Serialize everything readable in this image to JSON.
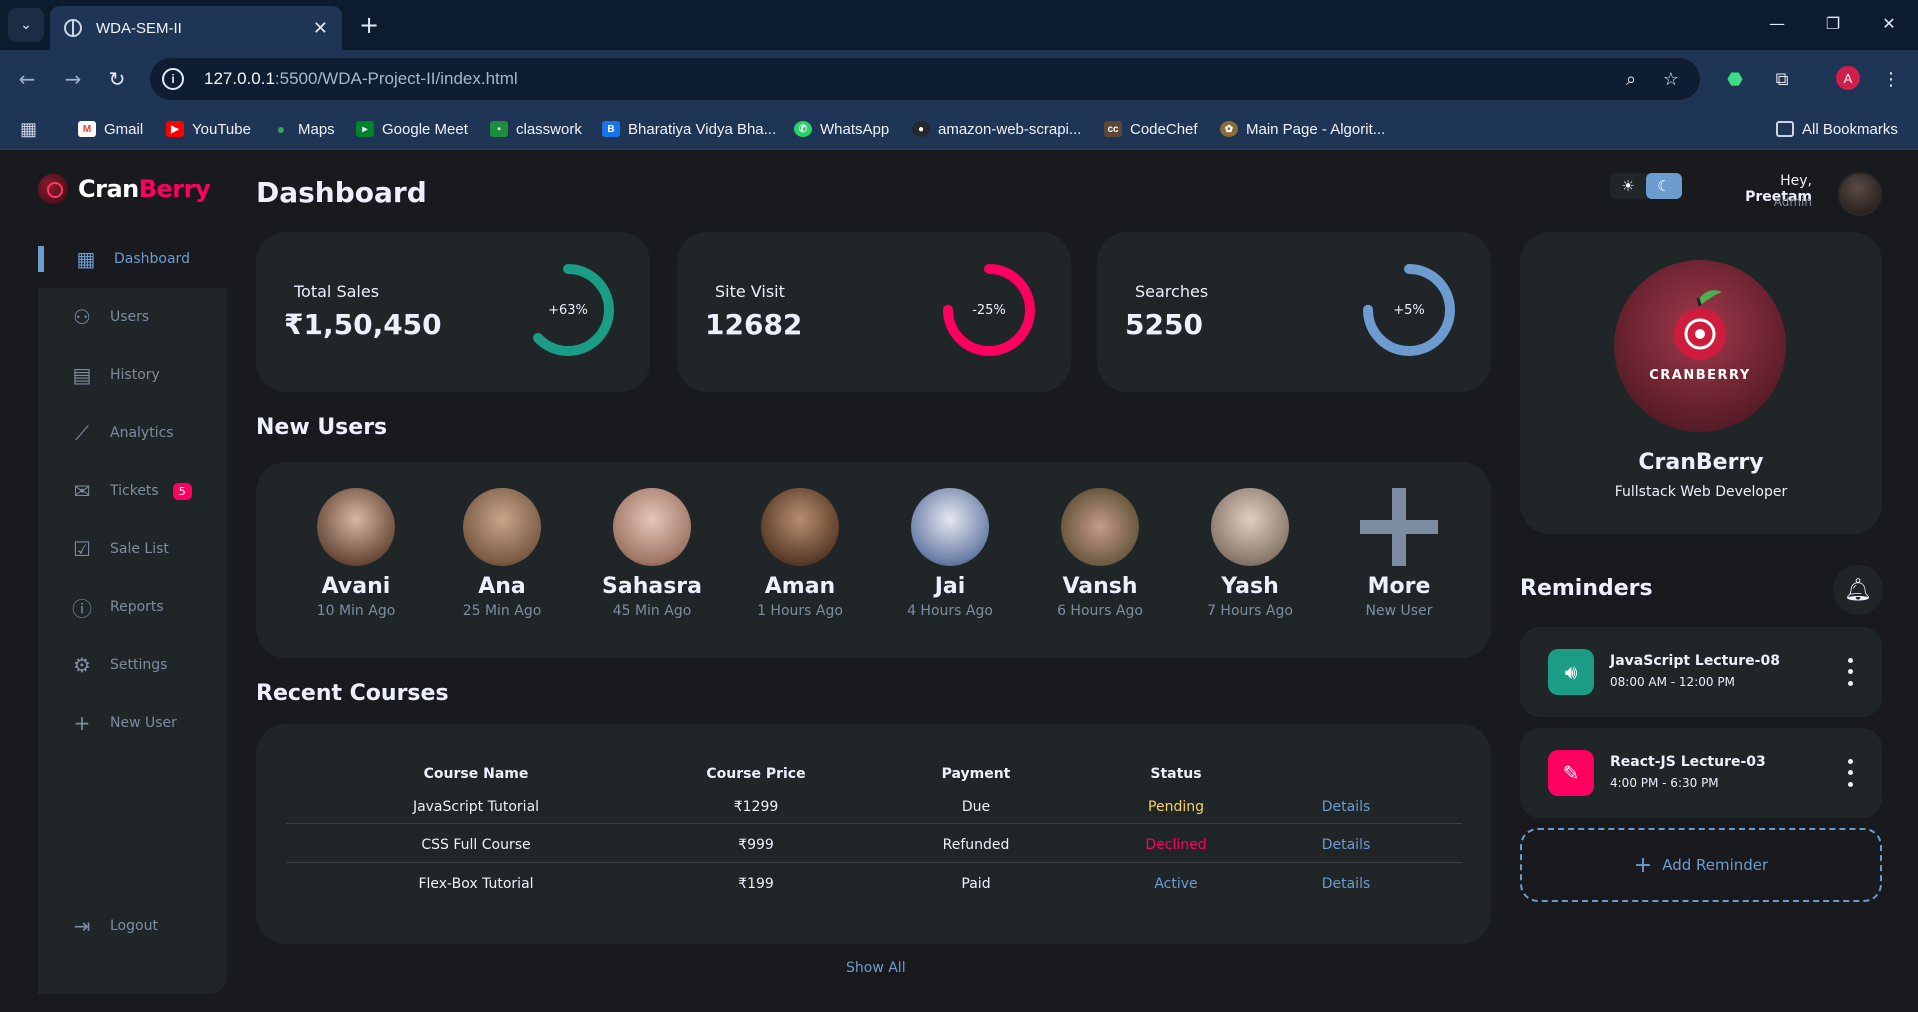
{
  "browser": {
    "tab_title": "WDA-SEM-II",
    "url_host": "127.0.0.1",
    "url_path": ":5500/WDA-Project-II/index.html",
    "profile_initial": "A",
    "bookmarks": [
      "Gmail",
      "YouTube",
      "Maps",
      "Google Meet",
      "classwork",
      "Bharatiya Vidya Bha...",
      "WhatsApp",
      "amazon-web-scrapi...",
      "CodeChef",
      "Main Page - Algorit..."
    ],
    "all_bookmarks": "All Bookmarks"
  },
  "logo": {
    "part1": "Cran",
    "part2": "Berry"
  },
  "sidebar": {
    "items": [
      {
        "label": "Dashboard",
        "icon": "grid-icon",
        "active": true
      },
      {
        "label": "Users",
        "icon": "person-icon"
      },
      {
        "label": "History",
        "icon": "receipt-icon"
      },
      {
        "label": "Analytics",
        "icon": "insights-icon"
      },
      {
        "label": "Tickets",
        "icon": "mail-icon",
        "badge": "5"
      },
      {
        "label": "Sale List",
        "icon": "inventory-icon"
      },
      {
        "label": "Reports",
        "icon": "report-icon"
      },
      {
        "label": "Settings",
        "icon": "gear-icon"
      },
      {
        "label": "New User",
        "icon": "plus-icon"
      }
    ],
    "logout": "Logout"
  },
  "page_title": "Dashboard",
  "header": {
    "greeting": "Hey,",
    "user_name": "Preetam",
    "role": "Admin"
  },
  "stats": [
    {
      "label": "Total Sales",
      "value": "₹1,50,450",
      "percent": "+63%",
      "fraction": 0.63,
      "color": "#1b9c85"
    },
    {
      "label": "Site Visit",
      "value": "12682",
      "percent": "-25%",
      "fraction": 0.75,
      "color": "#ff0060"
    },
    {
      "label": "Searches",
      "value": "5250",
      "percent": "+5%",
      "fraction": 0.75,
      "color": "#6c9bcf"
    }
  ],
  "new_users": {
    "title": "New Users",
    "users": [
      {
        "name": "Avani",
        "time": "10 Min Ago"
      },
      {
        "name": "Ana",
        "time": "25 Min Ago"
      },
      {
        "name": "Sahasra",
        "time": "45 Min Ago"
      },
      {
        "name": "Aman",
        "time": "1 Hours Ago"
      },
      {
        "name": "Jai",
        "time": "4 Hours Ago"
      },
      {
        "name": "Vansh",
        "time": "6 Hours Ago"
      },
      {
        "name": "Yash",
        "time": "7 Hours Ago"
      },
      {
        "name": "More",
        "time": "New User"
      }
    ]
  },
  "courses": {
    "title": "Recent Courses",
    "headers": [
      "Course Name",
      "Course Price",
      "Payment",
      "Status",
      ""
    ],
    "rows": [
      {
        "name": "JavaScript Tutorial",
        "price": "₹1299",
        "payment": "Due",
        "status": "Pending",
        "status_color": "#f7d060",
        "action": "Details"
      },
      {
        "name": "CSS Full Course",
        "price": "₹999",
        "payment": "Refunded",
        "status": "Declined",
        "status_color": "#ff0060",
        "action": "Details"
      },
      {
        "name": "Flex-Box Tutorial",
        "price": "₹199",
        "payment": "Paid",
        "status": "Active",
        "status_color": "#6c9bcf",
        "action": "Details"
      }
    ],
    "show_all": "Show All"
  },
  "profile": {
    "logo_text": "CRANBERRY",
    "name": "CranBerry",
    "role": "Fullstack Web Developer"
  },
  "reminders": {
    "title": "Reminders",
    "items": [
      {
        "name": "JavaScript Lecture-08",
        "time": "08:00 AM - 12:00 PM",
        "icon": "volume-icon",
        "color": "#1b9c85"
      },
      {
        "name": "React-JS Lecture-03",
        "time": "4:00 PM - 6:30 PM",
        "icon": "pencil-icon",
        "color": "#ff0060"
      }
    ],
    "add_label": "Add Reminder"
  }
}
